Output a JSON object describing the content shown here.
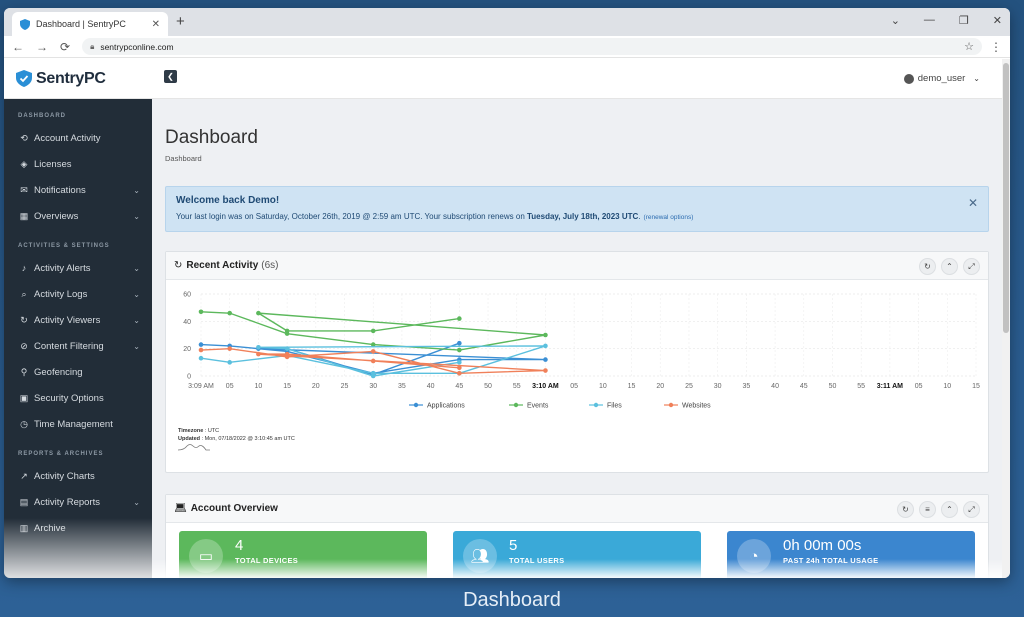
{
  "browser": {
    "tab_title": "Dashboard | SentryPC",
    "url": "sentrypconline.com"
  },
  "brand": {
    "logo_text": "SentryPC",
    "accent": "#2a8fd6"
  },
  "sidebar": {
    "sections": [
      {
        "heading": "DASHBOARD",
        "items": [
          {
            "label": "Account Activity",
            "icon": "history-icon",
            "chevron": false
          },
          {
            "label": "Licenses",
            "icon": "licenses-icon",
            "chevron": false
          },
          {
            "label": "Notifications",
            "icon": "envelope-icon",
            "chevron": true
          },
          {
            "label": "Overviews",
            "icon": "calendar-icon",
            "chevron": true
          }
        ]
      },
      {
        "heading": "ACTIVITIES & SETTINGS",
        "items": [
          {
            "label": "Activity Alerts",
            "icon": "bell-icon",
            "chevron": true
          },
          {
            "label": "Activity Logs",
            "icon": "search-icon",
            "chevron": true
          },
          {
            "label": "Activity Viewers",
            "icon": "refresh-icon",
            "chevron": true
          },
          {
            "label": "Content Filtering",
            "icon": "ban-icon",
            "chevron": true
          },
          {
            "label": "Geofencing",
            "icon": "pin-icon",
            "chevron": false
          },
          {
            "label": "Security Options",
            "icon": "lock-icon",
            "chevron": false
          },
          {
            "label": "Time Management",
            "icon": "clock-icon",
            "chevron": false
          }
        ]
      },
      {
        "heading": "REPORTS & ARCHIVES",
        "items": [
          {
            "label": "Activity Charts",
            "icon": "chart-icon",
            "chevron": false
          },
          {
            "label": "Activity Reports",
            "icon": "report-icon",
            "chevron": true
          },
          {
            "label": "Archive",
            "icon": "archive-icon",
            "chevron": false
          }
        ]
      }
    ]
  },
  "topbar": {
    "username": "demo_user"
  },
  "page": {
    "title": "Dashboard",
    "breadcrumb": "Dashboard"
  },
  "alert": {
    "title": "Welcome back Demo!",
    "body_prefix": "Your last login was on Saturday, October 26th, 2019 @ 2:59 am UTC.  Your subscription renews on ",
    "renew_date": "Tuesday, July 18th, 2023 UTC",
    "body_suffix": ".",
    "renew_link": "(renewal options)"
  },
  "activity_panel": {
    "title": "Recent Activity",
    "subtitle": "(6s)",
    "timezone_label": "Timezone",
    "timezone_value": ": UTC",
    "updated_label": "Updated",
    "updated_value": ": Mon, 07/18/2022 @ 3:10:45 am UTC"
  },
  "chart_data": {
    "type": "line",
    "ylim": [
      0,
      60
    ],
    "yticks": [
      0,
      20,
      40,
      60
    ],
    "x": [
      "3:09 AM",
      "05",
      "10",
      "15",
      "20",
      "25",
      "30",
      "35",
      "40",
      "45",
      "50",
      "55",
      "3:10 AM",
      "05",
      "10",
      "15",
      "20",
      "25",
      "30",
      "35",
      "40",
      "45",
      "50",
      "55",
      "3:11 AM",
      "05",
      "10",
      "15"
    ],
    "bold_ticks": [
      "3:10 AM",
      "3:11 AM"
    ],
    "series": [
      {
        "name": "Applications",
        "color": "#3b8fd4",
        "x": [
          "3:09 AM",
          "05",
          "15",
          "30",
          "45",
          "3:10 AM",
          "10",
          "15",
          "30",
          "45"
        ],
        "values": [
          23,
          22,
          18,
          2,
          12,
          12,
          20,
          20,
          1,
          24
        ]
      },
      {
        "name": "Events",
        "color": "#5cb85c",
        "x": [
          "3:09 AM",
          "05",
          "15",
          "30",
          "45",
          "3:10 AM",
          "10",
          "15",
          "30",
          "45"
        ],
        "values": [
          47,
          46,
          31,
          23,
          19,
          30,
          46,
          33,
          33,
          42
        ]
      },
      {
        "name": "Files",
        "color": "#5bc0de",
        "x": [
          "3:09 AM",
          "05",
          "15",
          "30",
          "45",
          "3:10 AM",
          "10",
          "15",
          "30",
          "45"
        ],
        "values": [
          13,
          10,
          15,
          2,
          2,
          22,
          21,
          20,
          0,
          10
        ]
      },
      {
        "name": "Websites",
        "color": "#f0805a",
        "x": [
          "3:09 AM",
          "05",
          "15",
          "30",
          "45",
          "3:10 AM",
          "10",
          "15",
          "30",
          "45"
        ],
        "values": [
          19,
          20,
          14,
          18,
          2,
          4,
          16,
          16,
          11,
          6
        ]
      }
    ]
  },
  "overview_panel": {
    "title": "Account Overview"
  },
  "stats": [
    {
      "value": "4",
      "label": "TOTAL DEVICES",
      "icon": "laptop-icon",
      "color": "#5cb85c"
    },
    {
      "value": "5",
      "label": "TOTAL USERS",
      "icon": "users-icon",
      "color": "#3aa9d8"
    },
    {
      "value": "0h 00m 00s",
      "label": "PAST 24h TOTAL USAGE",
      "icon": "stopwatch-icon",
      "color": "#3b86cf"
    }
  ],
  "caption": "Dashboard"
}
